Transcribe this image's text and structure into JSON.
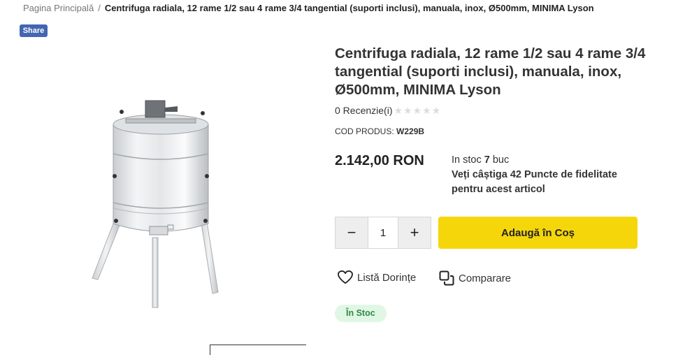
{
  "breadcrumb": {
    "home": "Pagina Principală",
    "separator": "/",
    "current": "Centrifuga radiala, 12 rame 1/2 sau 4 rame 3/4 tangential (suporti inclusi), manuala, inox, Ø500mm, MINIMA Lyson"
  },
  "share": {
    "label": "Share"
  },
  "product": {
    "title": "Centrifuga radiala, 12 rame 1/2 sau 4 rame 3/4 tangential (suporti inclusi), manuala, inox, Ø500mm, MINIMA Lyson",
    "reviews_label": "0 Recenzie(i)",
    "rating": 0,
    "rating_max": 5,
    "code_label": "COD PRODUS:",
    "code_value": "W229B",
    "price": "2.142,00 RON",
    "stock_prefix": "In stoc",
    "stock_count": "7",
    "stock_unit": "buc",
    "loyalty": "Veți câștiga 42 Puncte de fidelitate pentru acest articol",
    "stock_badge": "În Stoc"
  },
  "cart": {
    "minus_label": "−",
    "plus_label": "+",
    "quantity": "1",
    "add_label": "Adaugă în Coș"
  },
  "actions": {
    "wishlist_label": "Listă Dorințe",
    "compare_label": "Comparare"
  },
  "colors": {
    "add_to_cart": "#f5d60a",
    "share": "#4267b2",
    "stock_badge_bg": "#e1f7e6",
    "stock_badge_text": "#2f8a41"
  }
}
